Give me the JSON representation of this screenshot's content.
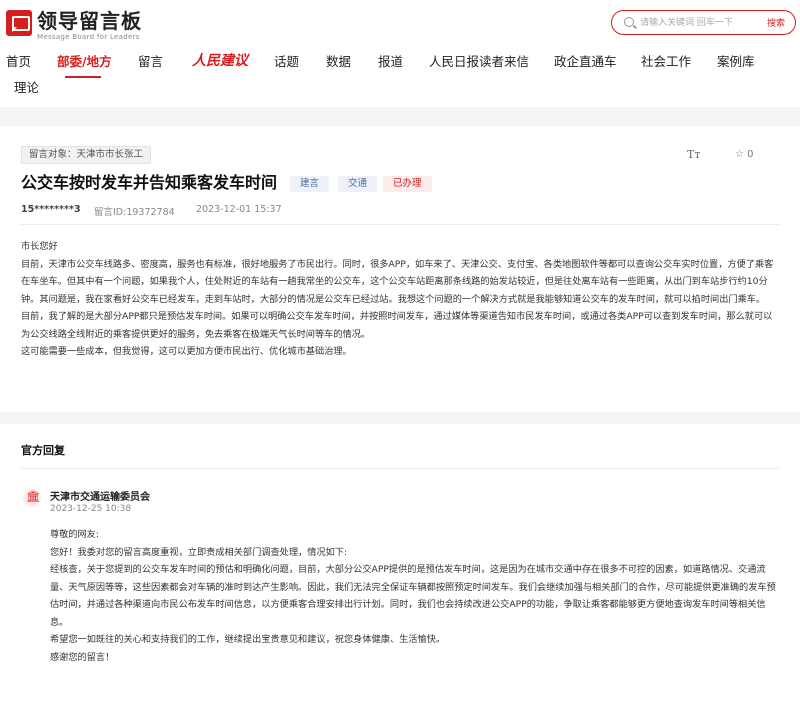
{
  "header": {
    "logo_title": "领导留言板",
    "logo_sub": "Message Board for Leaders",
    "search_placeholder": "请输入关键词 回车一下",
    "search_button": "搜索"
  },
  "nav": {
    "items": [
      "首页",
      "部委/地方",
      "留言",
      "人民建议",
      "话题",
      "数据",
      "报道",
      "人民日报读者来信",
      "政企直通车",
      "社会工作",
      "案例库",
      "理论"
    ],
    "active_index": 1
  },
  "message": {
    "target": "留言对象：天津市市长张工",
    "font_tool": "Tт",
    "favorite_count": "☆ 0",
    "title": "公交车按时发车并告知乘客发车时间",
    "badges": [
      "建言",
      "交通",
      "已办理"
    ],
    "user": "15********3",
    "id_text": "留言ID:19372784",
    "time": "2023-12-01 15:37",
    "paragraphs": [
      "市长您好",
      "目前，天津市公交车线路多、密度高，服务也有标准，很好地服务了市民出行。同时，很多APP，如车来了、天津公交、支付宝、各类地图软件等都可以查询公交车实时位置，方便了乘客在车坐车。但其中有一个问题，如果我个人，住处附近的车站有一趟我常坐的公交车，这个公交车站距离那条线路的始发站较近，但是往处离车站有一些距离，从出门到车站步行约10分钟。其问题是，我在家看好公交车已经发车，走到车站时，大部分的情况是公交车已经过站。我想这个问题的一个解决方式就是我能够知道公交车的发车时间，就可以掐时间出门乘车。",
      "目前，我了解的是大部分APP都只是预估发车时间。如果可以明确公交车发车时间，并按照时间发车，通过媒体等渠道告知市民发车时间，或通过各类APP可以查到发车时间，那么就可以为公交线路全线附近的乘客提供更好的服务，免去乘客在极端天气长时间等车的情况。",
      "这可能需要一些成本，但我觉得，这可以更加方便市民出行、优化城市基础治理。"
    ]
  },
  "reply": {
    "heading": "官方回复",
    "dept": "天津市交通运输委员会",
    "time": "2023-12-25 10:38",
    "paragraphs": [
      "尊敬的网友:",
      "您好！我委对您的留言高度重视，立即责成相关部门调查处理，情况如下:",
      "经核查，关于您提到的公交车发车时间的预估和明确化问题，目前，大部分公交APP提供的是预估发车时间，这是因为在城市交通中存在很多不可控的因素，如道路情况、交通流量、天气原因等等，这些因素都会对车辆的准时到达产生影响。因此，我们无法完全保证车辆都按照预定时间发车。我们会继续加强与相关部门的合作，尽可能提供更准确的发车预估时间，并通过各种渠道向市民公布发车时间信息，以方便乘客合理安排出行计划。同时，我们也会持续改进公交APP的功能，争取让乘客都能够更方便地查询发车时间等相关信息。",
      "希望您一如既往的关心和支持我们的工作，继续提出宝贵意见和建议，祝您身体健康、生活愉快。",
      "感谢您的留言！"
    ]
  },
  "colors": {
    "accent": "#d61e1e",
    "badge_blue": "#4a6fa5",
    "background": "#f4f4f4"
  }
}
